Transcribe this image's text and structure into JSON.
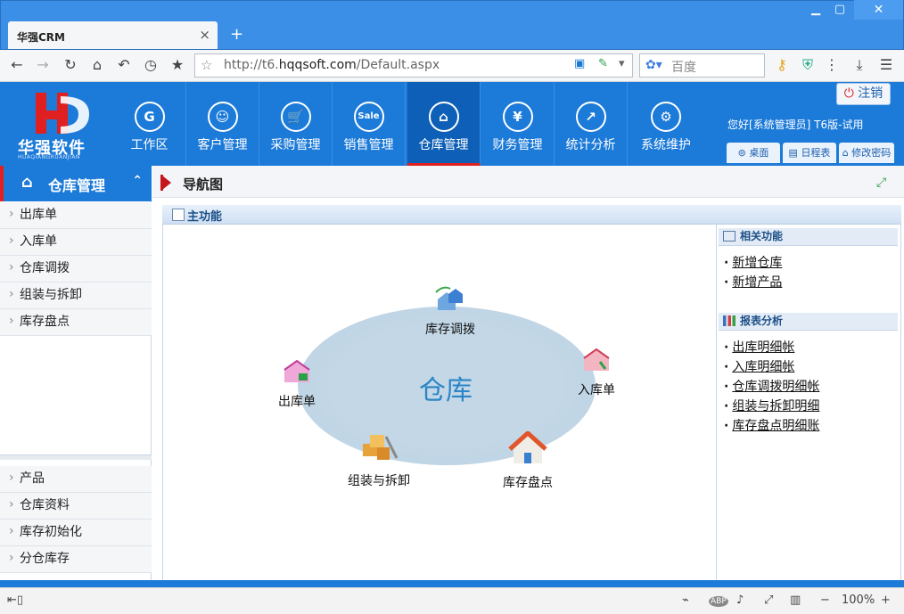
{
  "browser": {
    "tab_title": "华强CRM",
    "tab_close": "×",
    "new_tab": "+",
    "url_prefix": "http://t6.",
    "url_domain": "hqqsoft.com",
    "url_path": "/Default.aspx",
    "search_placeholder": "百度",
    "zoom": "100%",
    "icons": [
      "back-icon",
      "forward-icon",
      "reload-icon",
      "home-icon",
      "undo-icon",
      "history-icon",
      "bookmark-star-icon",
      "download-icon",
      "menu-icon"
    ]
  },
  "app": {
    "logo_text": "华强软件",
    "logo_subtext": "HUAQIANGRUANJIAN",
    "logout_label": "注销",
    "user_info": "您好[系统管理员] T6版-试用",
    "header_buttons": [
      "桌面",
      "日程表",
      "修改密码"
    ],
    "modules": [
      {
        "label": "工作区",
        "icon": "G",
        "active": false
      },
      {
        "label": "客户管理",
        "icon": "☺",
        "active": false
      },
      {
        "label": "采购管理",
        "icon": "🛒",
        "active": false
      },
      {
        "label": "销售管理",
        "icon": "Sale",
        "active": false
      },
      {
        "label": "仓库管理",
        "icon": "⌂",
        "active": true
      },
      {
        "label": "财务管理",
        "icon": "¥",
        "active": false
      },
      {
        "label": "统计分析",
        "icon": "↗",
        "active": false
      },
      {
        "label": "系统维护",
        "icon": "⚙",
        "active": false
      }
    ]
  },
  "sidebar": {
    "title": "仓库管理",
    "items": [
      "出库单",
      "入库单",
      "仓库调拨",
      "组装与拆卸",
      "库存盘点"
    ],
    "items_bottom": [
      "产品",
      "仓库资料",
      "库存初始化",
      "分仓库存"
    ]
  },
  "content": {
    "crumb_title": "导航图",
    "panel_title": "主功能",
    "diagram": {
      "center_label": "仓库",
      "nodes": [
        "库存调拨",
        "入库单",
        "出库单",
        "组装与拆卸",
        "库存盘点"
      ]
    },
    "related": {
      "title": "相关功能",
      "links": [
        "新增仓库",
        "新增产品"
      ]
    },
    "reports": {
      "title": "报表分析",
      "links": [
        "出库明细帐",
        "入库明细帐",
        "仓库调拨明细帐",
        "组装与拆卸明细",
        "库存盘点明细账"
      ]
    }
  },
  "colors": {
    "primary": "#1c7ad8",
    "accent_red": "#e02020",
    "active_module": "#0e5fb7"
  }
}
